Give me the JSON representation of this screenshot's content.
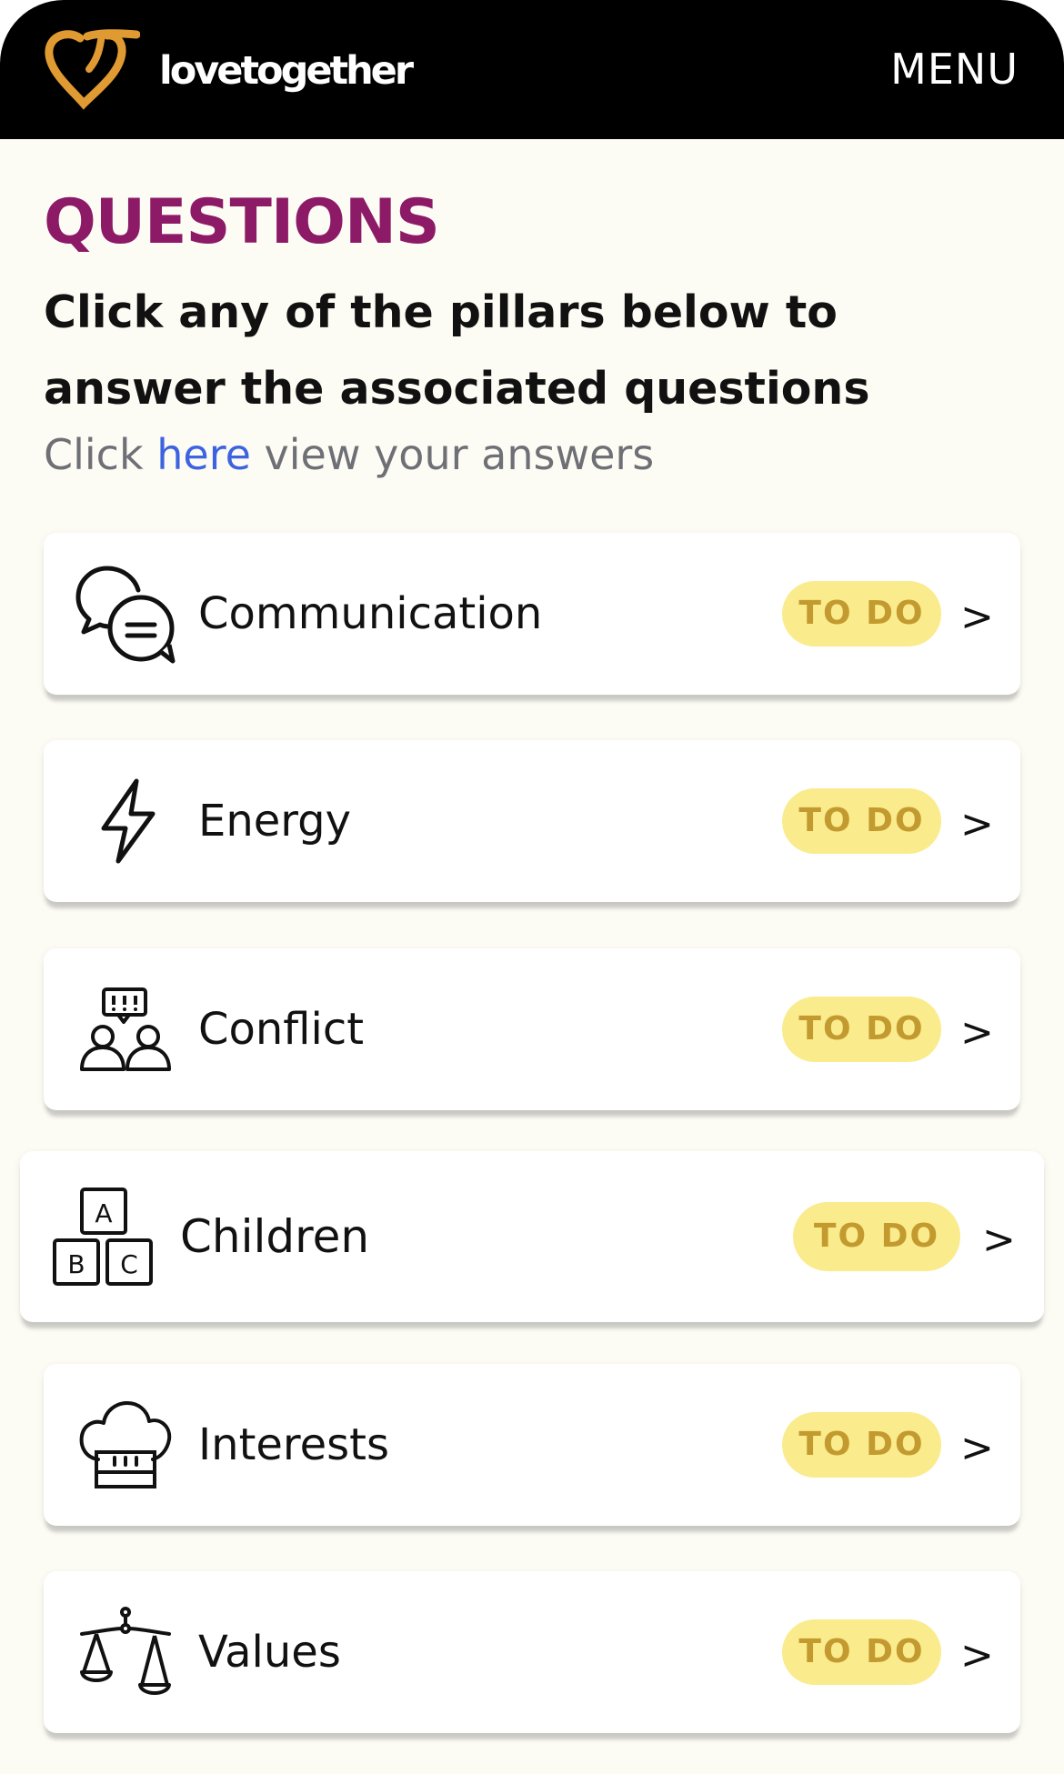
{
  "header": {
    "brand": "lovetogether",
    "menu_label": "MENU",
    "logo_icon": "heart-logo-icon",
    "colors": {
      "bar": "#000000",
      "logo_accent": "#e09a32",
      "text": "#ffffff"
    }
  },
  "main": {
    "title": "QUESTIONS",
    "instructions": "Click any of the pillars below to answer the associated questions",
    "answers_prefix": "Click",
    "answers_link": "here",
    "answers_suffix": "view your answers"
  },
  "pillars": [
    {
      "label": "Communication",
      "status": "TO DO",
      "chevron": ">",
      "icon": "chat-bubbles-icon"
    },
    {
      "label": "Energy",
      "status": "TO DO",
      "chevron": ">",
      "icon": "lightning-bolt-icon"
    },
    {
      "label": "Conflict",
      "status": "TO DO",
      "chevron": ">",
      "icon": "people-arguing-icon"
    },
    {
      "label": "Children",
      "status": "TO DO",
      "chevron": ">",
      "icon": "abc-blocks-icon"
    },
    {
      "label": "Interests",
      "status": "TO DO",
      "chevron": ">",
      "icon": "chef-hat-icon"
    },
    {
      "label": "Values",
      "status": "TO DO",
      "chevron": ">",
      "icon": "balance-scale-icon"
    }
  ],
  "colors": {
    "background": "#fdfcf4",
    "title": "#8c1a66",
    "link": "#3d63e0",
    "muted_text": "#6f7076",
    "badge_bg": "#faeb8c",
    "badge_text": "#c39a2f"
  }
}
